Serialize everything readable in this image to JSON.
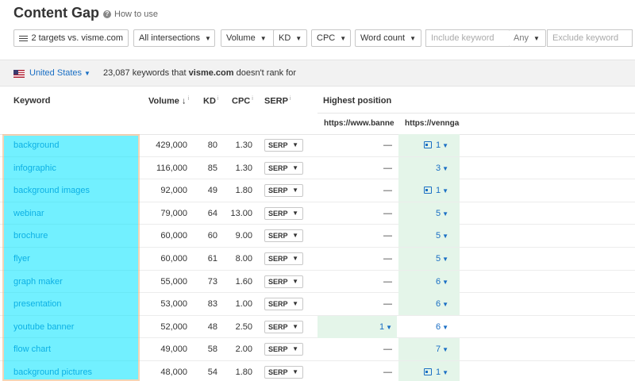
{
  "header": {
    "title": "Content Gap",
    "how_to_use": "How to use"
  },
  "filters": {
    "targets": "2 targets vs. visme.com",
    "intersections": "All intersections",
    "volume": "Volume",
    "kd": "KD",
    "cpc": "CPC",
    "word_count": "Word count",
    "include_placeholder": "Include keyword",
    "any": "Any",
    "exclude_placeholder": "Exclude keyword"
  },
  "country_bar": {
    "country": "United States",
    "count": "23,087",
    "summary_pre": "keywords that",
    "domain": "visme.com",
    "summary_post": "doesn't rank for"
  },
  "table": {
    "headers": {
      "keyword": "Keyword",
      "volume": "Volume ↓",
      "kd": "KD",
      "cpc": "CPC",
      "serp": "SERP",
      "highest_position": "Highest position",
      "target1": "https://www.banne",
      "target2": "https://venngag"
    },
    "serp_label": "SERP",
    "rows": [
      {
        "keyword": "background",
        "volume": "429,000",
        "kd": "80",
        "cpc": "1.30",
        "pos1": "—",
        "pos2": "1",
        "pos2_image": true
      },
      {
        "keyword": "infographic",
        "volume": "116,000",
        "kd": "85",
        "cpc": "1.30",
        "pos1": "—",
        "pos2": "3",
        "pos2_image": false
      },
      {
        "keyword": "background images",
        "volume": "92,000",
        "kd": "49",
        "cpc": "1.80",
        "pos1": "—",
        "pos2": "1",
        "pos2_image": true
      },
      {
        "keyword": "webinar",
        "volume": "79,000",
        "kd": "64",
        "cpc": "13.00",
        "pos1": "—",
        "pos2": "5",
        "pos2_image": false
      },
      {
        "keyword": "brochure",
        "volume": "60,000",
        "kd": "60",
        "cpc": "9.00",
        "pos1": "—",
        "pos2": "5",
        "pos2_image": false
      },
      {
        "keyword": "flyer",
        "volume": "60,000",
        "kd": "61",
        "cpc": "8.00",
        "pos1": "—",
        "pos2": "5",
        "pos2_image": false
      },
      {
        "keyword": "graph maker",
        "volume": "55,000",
        "kd": "73",
        "cpc": "1.60",
        "pos1": "—",
        "pos2": "6",
        "pos2_image": false
      },
      {
        "keyword": "presentation",
        "volume": "53,000",
        "kd": "83",
        "cpc": "1.00",
        "pos1": "—",
        "pos2": "6",
        "pos2_image": false
      },
      {
        "keyword": "youtube banner",
        "volume": "52,000",
        "kd": "48",
        "cpc": "2.50",
        "pos1": "1",
        "pos2": "6",
        "pos2_image": false
      },
      {
        "keyword": "flow chart",
        "volume": "49,000",
        "kd": "58",
        "cpc": "2.00",
        "pos1": "—",
        "pos2": "7",
        "pos2_image": false
      },
      {
        "keyword": "background pictures",
        "volume": "48,000",
        "kd": "54",
        "cpc": "1.80",
        "pos1": "—",
        "pos2": "1",
        "pos2_image": true
      }
    ]
  },
  "colors": {
    "link": "#1a6fc4",
    "best_position_bg": "#e4f5e9",
    "highlight": "#00e5ff"
  }
}
